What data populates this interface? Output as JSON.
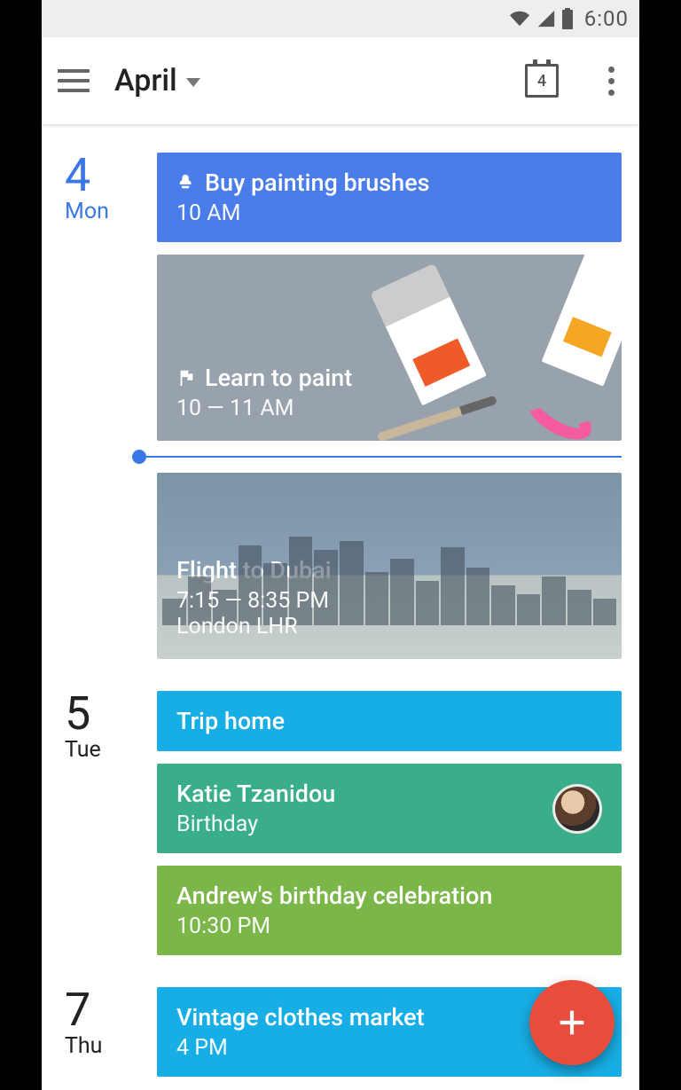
{
  "status": {
    "time": "6:00"
  },
  "header": {
    "month": "April",
    "today_day": "4"
  },
  "days": [
    {
      "num": "4",
      "dow": "Mon",
      "is_today": true,
      "events": [
        {
          "kind": "reminder",
          "title": "Buy painting brushes",
          "time": "10 AM",
          "color": "bg-blue"
        },
        {
          "kind": "image-paint",
          "title": "Learn to paint",
          "time": "10 — 11 AM"
        },
        {
          "kind": "now-line"
        },
        {
          "kind": "image-city",
          "title": "Flight to Dubai",
          "time": "7:15 — 8:35 PM",
          "location": "London LHR"
        }
      ]
    },
    {
      "num": "5",
      "dow": "Tue",
      "is_today": false,
      "events": [
        {
          "kind": "simple",
          "title": "Trip home",
          "color": "bg-cyan"
        },
        {
          "kind": "birthday",
          "title": "Katie Tzanidou",
          "sub": "Birthday",
          "color": "bg-teal"
        },
        {
          "kind": "simple",
          "title": "Andrew's birthday celebration",
          "time": "10:30 PM",
          "color": "bg-olive"
        }
      ]
    },
    {
      "num": "7",
      "dow": "Thu",
      "is_today": false,
      "events": [
        {
          "kind": "simple",
          "title": "Vintage clothes market",
          "time": "4 PM",
          "color": "bg-cyan",
          "avatar": true
        }
      ]
    }
  ]
}
